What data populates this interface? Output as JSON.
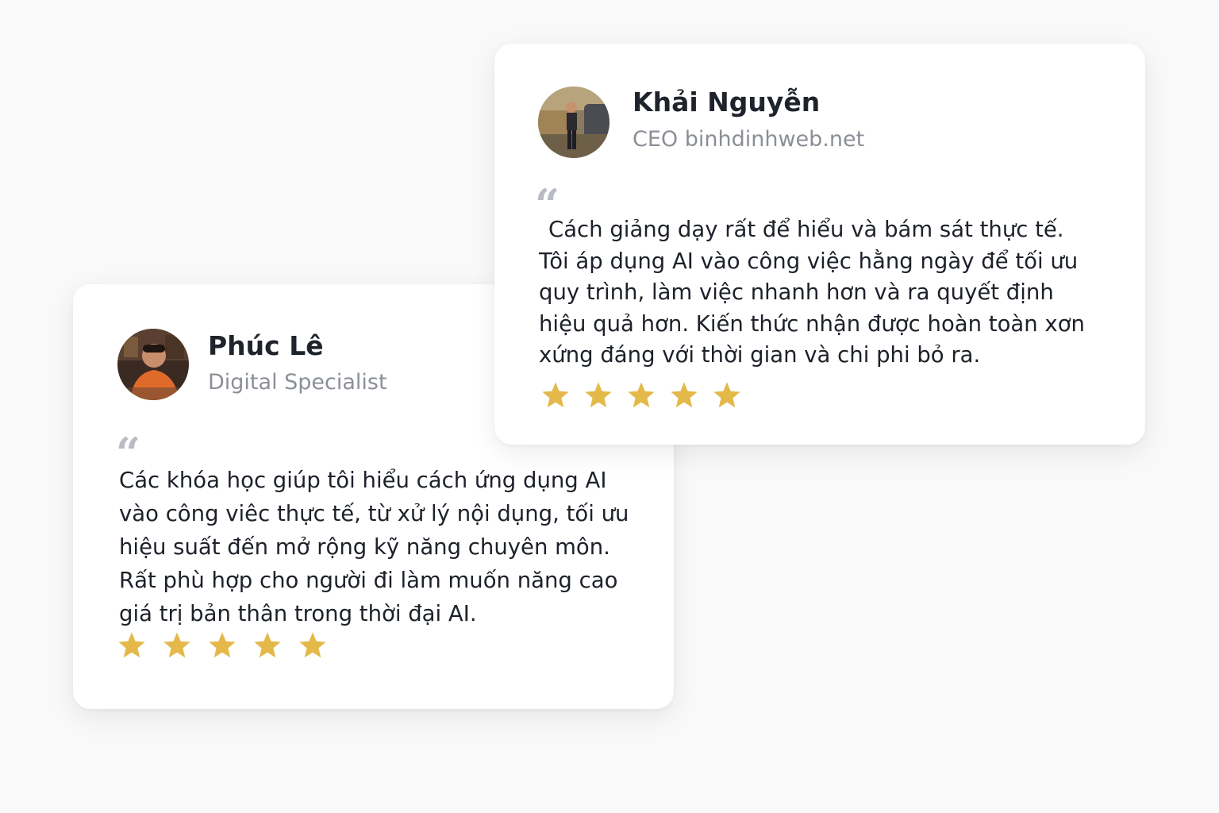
{
  "testimonials": [
    {
      "name": "Khải Nguyễn",
      "role": "CEO binhdinhweb.net",
      "quote_mark": "“",
      "lines": [
        "Cách giảng dạy rất để hiểu và bám sát thực tế.",
        "Tôi áp dụng AI vào công việc hằng ngày để tối ưu",
        "quy trình, làm việc nhanh hơn và ra quyết  định",
        "hiệu quả hơn. Kiến thức nhận được hoàn toàn xơn",
        "xứng đáng với thời gian và chi phi bỏ ra."
      ],
      "rating": 5,
      "star_glyph": "star-icon"
    },
    {
      "name": "Phúc Lê",
      "role": "Digital Specialist",
      "quote_mark": "“",
      "lines": [
        "Các khóa học giúp tôi hiểu cách ứng dụng AI",
        "vào công viêc thực tế, từ xử lý nội dụng, tối ưu",
        "hiệu suất đến mở rộng kỹ năng chuyên môn.",
        "Rất phù hợp cho người đi làm muốn năng cao",
        "giá trị bản thân trong thời đại AI."
      ],
      "rating": 5,
      "star_glyph": "star-icon"
    }
  ],
  "colors": {
    "background": "#f9f9f9",
    "card": "#ffffff",
    "name": "#1f232b",
    "role": "#8b8f96",
    "quote_mark": "#b9bcc2",
    "text": "#1d2129",
    "star": "#e4b94a"
  }
}
